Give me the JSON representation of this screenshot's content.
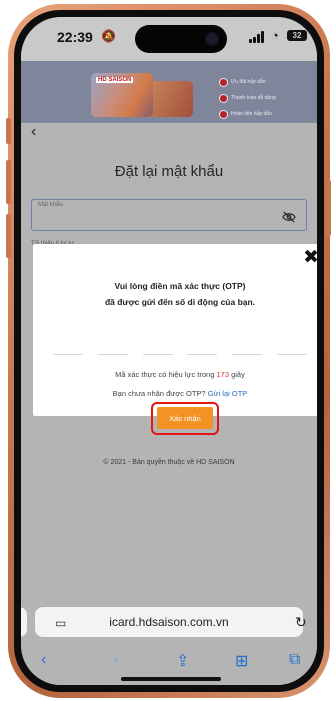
{
  "status_bar": {
    "time": "22:39",
    "battery": "32",
    "icons": [
      "bell-icon",
      "signal-icon",
      "wifi-icon",
      "battery-icon"
    ]
  },
  "banner": {
    "card_logo": "HD SAISON",
    "bullets": [
      "Ưu đãi hấp dẫn",
      "Thanh toán dễ dàng",
      "Hoàn tiền hấp dẫn"
    ]
  },
  "page": {
    "title": "Đặt lại mật khẩu",
    "password_label": "Mật khẩu",
    "under_text": "Tối thiểu 8 ký tự",
    "copyright": "© 2021 - Bản quyền thuộc về HD SAISON"
  },
  "modal": {
    "line1": "Vui lòng điền mã xác thực (OTP)",
    "line2": "đã được gửi đến số di động của bạn.",
    "validity_prefix": "Mã xác thực có hiệu lực trong",
    "seconds": "173",
    "validity_suffix": "giây",
    "resend_prefix": "Bạn chưa nhận được OTP?",
    "resend_link": "Gửi lại OTP",
    "confirm": "Xác nhận",
    "close_glyph": "✖"
  },
  "browser": {
    "url": "icard.hdsaison.com.vn",
    "nav_icons": [
      "back-icon",
      "forward-icon",
      "share-icon",
      "bookmarks-icon",
      "tabs-icon"
    ]
  },
  "colors": {
    "accent_orange": "#f39325",
    "highlight_red": "#e21616",
    "link_blue": "#2a6fb3",
    "countdown_red": "#e03030"
  }
}
